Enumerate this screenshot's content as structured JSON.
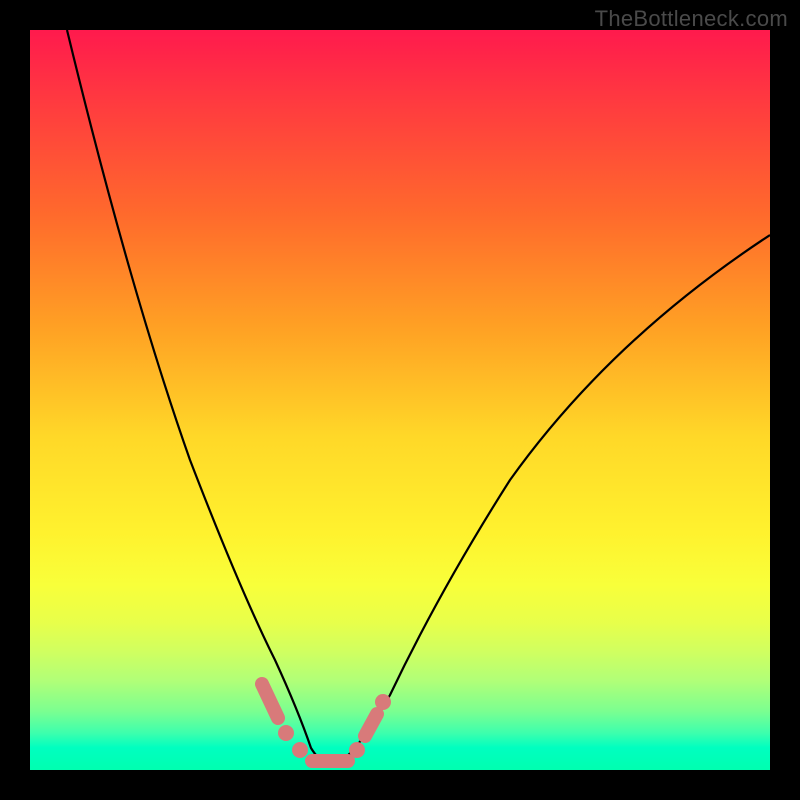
{
  "watermark": "TheBottleneck.com",
  "chart_data": {
    "type": "line",
    "title": "",
    "xlabel": "",
    "ylabel": "",
    "xlim": [
      0,
      100
    ],
    "ylim": [
      0,
      100
    ],
    "grid": false,
    "series": [
      {
        "name": "left-curve",
        "x": [
          5,
          8,
          12,
          16,
          20,
          24,
          27,
          30,
          32,
          34,
          36,
          38
        ],
        "y": [
          100,
          85,
          70,
          55,
          40,
          27,
          18,
          11,
          7,
          4,
          2,
          1
        ]
      },
      {
        "name": "right-curve",
        "x": [
          42,
          45,
          50,
          55,
          62,
          70,
          80,
          90,
          100
        ],
        "y": [
          1,
          3,
          8,
          15,
          25,
          37,
          50,
          62,
          72
        ]
      }
    ],
    "markers": [
      {
        "kind": "segment",
        "x": [
          30,
          32.5
        ],
        "y": [
          11,
          6
        ]
      },
      {
        "kind": "dot",
        "x": 33.5,
        "y": 4
      },
      {
        "kind": "dot",
        "x": 35.5,
        "y": 2
      },
      {
        "kind": "segment",
        "x": [
          37,
          42
        ],
        "y": [
          1,
          1
        ]
      },
      {
        "kind": "dot",
        "x": 43.5,
        "y": 2.5
      },
      {
        "kind": "segment",
        "x": [
          44.5,
          46
        ],
        "y": [
          4,
          6.5
        ]
      },
      {
        "kind": "dot",
        "x": 46.8,
        "y": 8.5
      }
    ],
    "background_gradient": {
      "top": "#ff1a4d",
      "mid": "#fff22e",
      "bottom": "#00ffb0"
    }
  }
}
